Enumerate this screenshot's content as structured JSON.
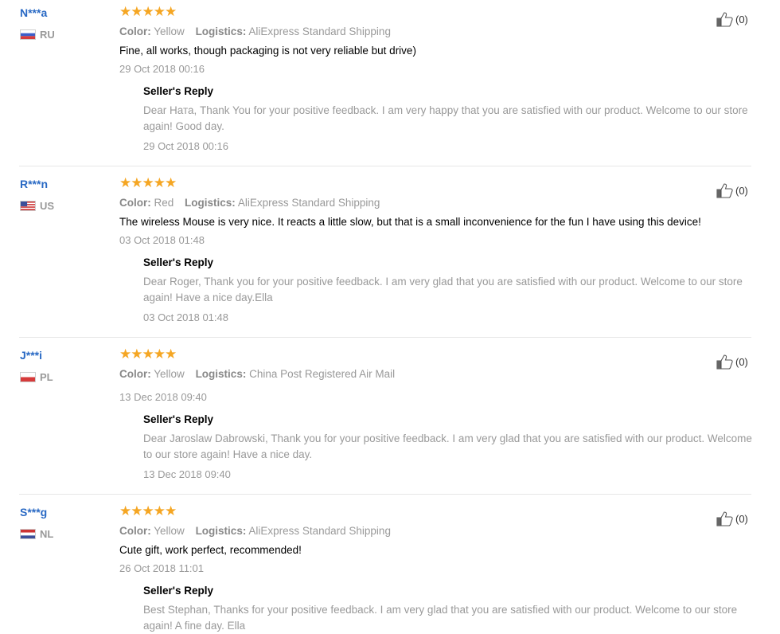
{
  "labels": {
    "color": "Color:",
    "logistics": "Logistics:",
    "seller_reply": "Seller's Reply",
    "stars": "★★★★★"
  },
  "reviews": [
    {
      "user": "N***a",
      "country": "RU",
      "flag": "ru",
      "color": "Yellow",
      "logistics": "AliExpress Standard Shipping",
      "text": "Fine, all works, though packaging is not very reliable but drive)",
      "date": "29 Oct 2018 00:16",
      "reply": "Dear Ната, Thank You for your positive feedback. I am very happy that you are satisfied with our product. Welcome to our store again! Good day.",
      "reply_date": "29 Oct 2018 00:16",
      "likes": "(0)"
    },
    {
      "user": "R***n",
      "country": "US",
      "flag": "us",
      "color": "Red",
      "logistics": "AliExpress Standard Shipping",
      "text": "The wireless Mouse is very nice. It reacts a little slow, but that is a small inconvenience for the fun I have using this device!",
      "date": "03 Oct 2018 01:48",
      "reply": "Dear Roger, Thank you for your positive feedback. I am very glad that you are satisfied with our product. Welcome to our store again! Have a nice day.Ella",
      "reply_date": "03 Oct 2018 01:48",
      "likes": "(0)"
    },
    {
      "user": "J***i",
      "country": "PL",
      "flag": "pl",
      "color": "Yellow",
      "logistics": "China Post Registered Air Mail",
      "text": "",
      "date": "13 Dec 2018 09:40",
      "reply": "Dear Jaroslaw Dabrowski, Thank you for your positive feedback. I am very glad that you are satisfied with our product. Welcome to our store again! Have a nice day.",
      "reply_date": "13 Dec 2018 09:40",
      "likes": "(0)"
    },
    {
      "user": "S***g",
      "country": "NL",
      "flag": "nl",
      "color": "Yellow",
      "logistics": "AliExpress Standard Shipping",
      "text": "Cute gift, work perfect, recommended!",
      "date": "26 Oct 2018 11:01",
      "reply": "Best Stephan, Thanks for your positive feedback. I am very glad that you are satisfied with our product. Welcome to our store again! A fine day. Ella",
      "reply_date": "",
      "likes": "(0)"
    }
  ],
  "colors": {
    "username": "#2969c4",
    "star": "#f5a623",
    "muted": "#999999"
  }
}
